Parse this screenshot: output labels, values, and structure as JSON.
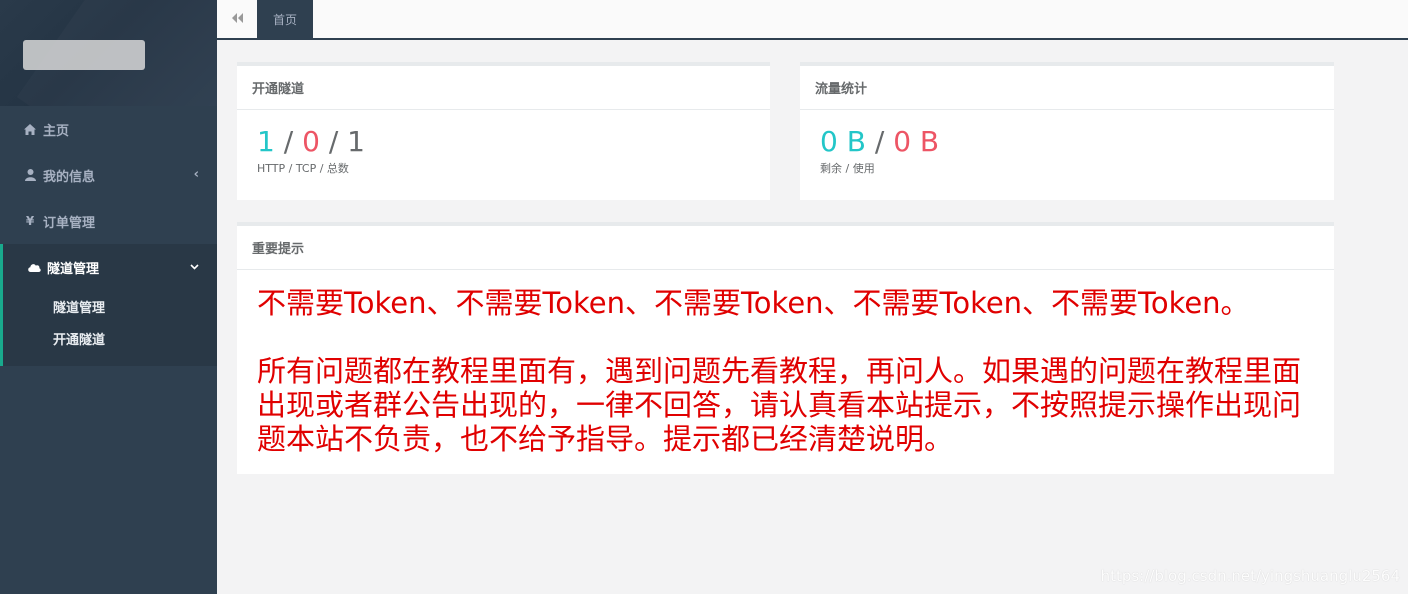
{
  "sidebar": {
    "items": [
      {
        "label": "主页",
        "icon": "home-icon"
      },
      {
        "label": "我的信息",
        "icon": "user-icon"
      },
      {
        "label": "订单管理",
        "icon": "yen-icon"
      },
      {
        "label": "隧道管理",
        "icon": "cloud-icon"
      }
    ],
    "submenu": [
      "隧道管理",
      "开通隧道"
    ]
  },
  "topbar": {
    "tab_label": "首页"
  },
  "tunnels": {
    "title": "开通隧道",
    "http": "1",
    "tcp": "0",
    "total": "1",
    "sep": "/",
    "subtitle": "HTTP / TCP / 总数"
  },
  "traffic": {
    "title": "流量统计",
    "remaining": "0 B",
    "used": "0 B",
    "sep": "/",
    "subtitle": "剩余 / 使用"
  },
  "notice": {
    "title": "重要提示",
    "line1": "不需要Token、不需要Token、不需要Token、不需要Token、不需要Token。",
    "line2": "所有问题都在教程里面有，遇到问题先看教程，再问人。如果遇的问题在教程里面出现或者群公告出现的，一律不回答，请认真看本站提示，不按照提示操作出现问题本站不负责，也不给予指导。提示都已经清楚说明。"
  },
  "watermark": "https://blog.csdn.net/yingshuanglu2564",
  "colors": {
    "sidebar_bg": "#2f4050",
    "accent_green": "#19aa8d",
    "teal": "#23c6c8",
    "red": "#ed5565",
    "notice_red": "#e00000"
  }
}
